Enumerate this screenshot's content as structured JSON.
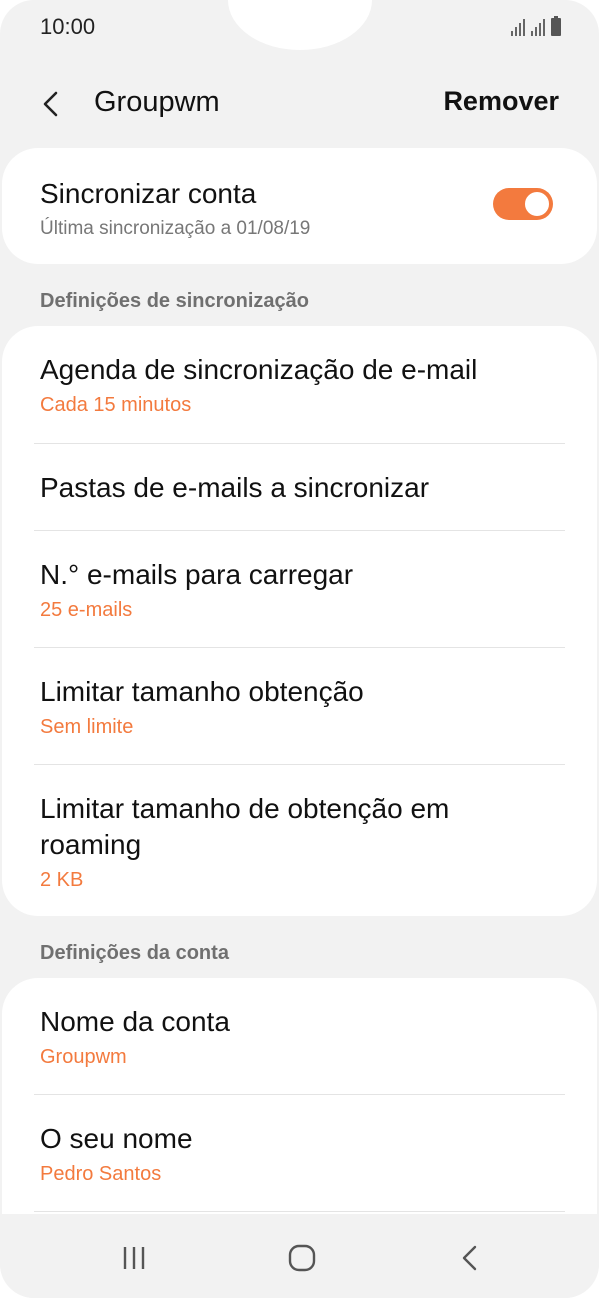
{
  "status_bar": {
    "time": "10:00"
  },
  "app_bar": {
    "title": "Groupwm",
    "action": "Remover"
  },
  "account_sync": {
    "title": "Sincronizar conta",
    "subtitle": "Última sincronização a 01/08/19",
    "enabled": true
  },
  "sync_settings": {
    "header": "Definições de sincronização",
    "items": [
      {
        "title": "Agenda de sincronização de e-mail",
        "value": "Cada 15 minutos"
      },
      {
        "title": "Pastas de e-mails a sincronizar"
      },
      {
        "title": "N.° e-mails para carregar",
        "value": "25 e-mails"
      },
      {
        "title": "Limitar tamanho obtenção",
        "value": "Sem limite"
      },
      {
        "title_line1": "Limitar tamanho de obtenção em",
        "title_line2": "roaming",
        "value": "2 KB"
      }
    ]
  },
  "account_settings": {
    "header": "Definições da conta",
    "items": [
      {
        "title": "Nome da conta",
        "value": "Groupwm"
      },
      {
        "title": "O seu nome",
        "value": "Pedro Santos"
      }
    ]
  },
  "colors": {
    "accent": "#f37a3e",
    "background": "#f2f2f2",
    "card": "#ffffff"
  }
}
